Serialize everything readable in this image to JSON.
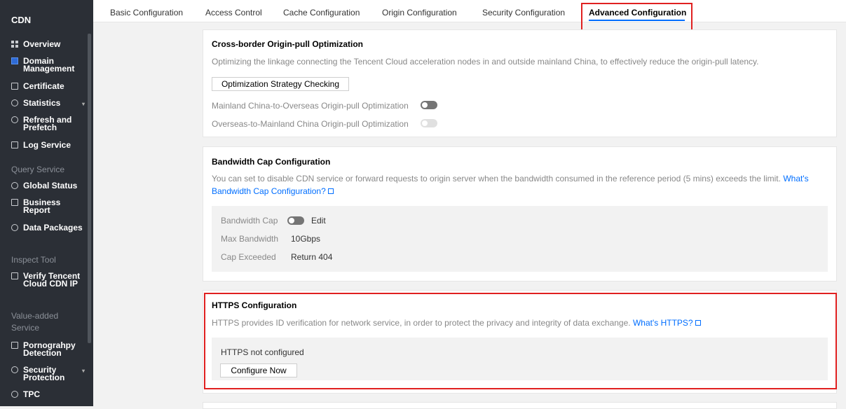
{
  "sidebar": {
    "title": "CDN",
    "items": [
      {
        "label": "Overview",
        "icon": "grid-icon"
      },
      {
        "label": "Domain Management",
        "icon": "domain-icon",
        "active": true
      },
      {
        "label": "Certificate",
        "icon": "certificate-icon"
      },
      {
        "label": "Statistics",
        "icon": "statistics-icon",
        "arrow": "▾"
      },
      {
        "label": "Refresh and Prefetch",
        "icon": "refresh-icon"
      },
      {
        "label": "Log Service",
        "icon": "log-icon"
      }
    ],
    "sections": [
      {
        "label": "Query Service"
      },
      {
        "label": "Inspect Tool"
      },
      {
        "label": "Value-added Service"
      }
    ],
    "query_items": [
      {
        "label": "Global Status",
        "icon": "global-status-icon"
      },
      {
        "label": "Business Report",
        "icon": "report-icon"
      },
      {
        "label": "Data Packages",
        "icon": "package-icon"
      }
    ],
    "inspect_items": [
      {
        "label": "Verify Tencent Cloud CDN IP",
        "icon": "verify-icon"
      }
    ],
    "value_items": [
      {
        "label": "Pornograhpy Detection",
        "icon": "detection-icon"
      },
      {
        "label": "Security Protection",
        "icon": "security-icon",
        "arrow": "▾"
      },
      {
        "label": "TPC",
        "icon": "tpc-icon"
      }
    ]
  },
  "tabs": [
    {
      "label": "Basic Configuration"
    },
    {
      "label": "Access Control"
    },
    {
      "label": "Cache Configuration"
    },
    {
      "label": "Origin Configuration"
    },
    {
      "label": "Security Configuration"
    },
    {
      "label": "Advanced Configuration",
      "active": true
    }
  ],
  "cross_border": {
    "title": "Cross-border Origin-pull Optimization",
    "description": "Optimizing the linkage connecting the Tencent Cloud acceleration nodes in and outside mainland China, to effectively reduce the origin-pull latency.",
    "button": "Optimization Strategy Checking",
    "option1": "Mainland China-to-Overseas Origin-pull Optimization",
    "option2": "Overseas-to-Mainland China Origin-pull Optimization"
  },
  "bandwidth": {
    "title": "Bandwidth Cap Configuration",
    "description": "You can set to disable CDN service or forward requests to origin server when the bandwidth consumed in the reference period (5 mins) exceeds the limit.",
    "link_part1": "What's",
    "link_part2": "Bandwidth Cap Configuration?",
    "cap_label": "Bandwidth Cap",
    "edit": "Edit",
    "max_label": "Max Bandwidth",
    "max_value": "10Gbps",
    "exceeded_label": "Cap Exceeded",
    "exceeded_value": "Return 404"
  },
  "https": {
    "title": "HTTPS Configuration",
    "description": "HTTPS provides ID verification for network service, in order to protect the privacy and integrity of data exchange.",
    "link": "What's HTTPS?",
    "status": "HTTPS not configured",
    "button": "Configure Now"
  },
  "colors": {
    "sidebar_bg": "#2b2f36",
    "accent": "#006eff",
    "highlight": "#e02020"
  }
}
